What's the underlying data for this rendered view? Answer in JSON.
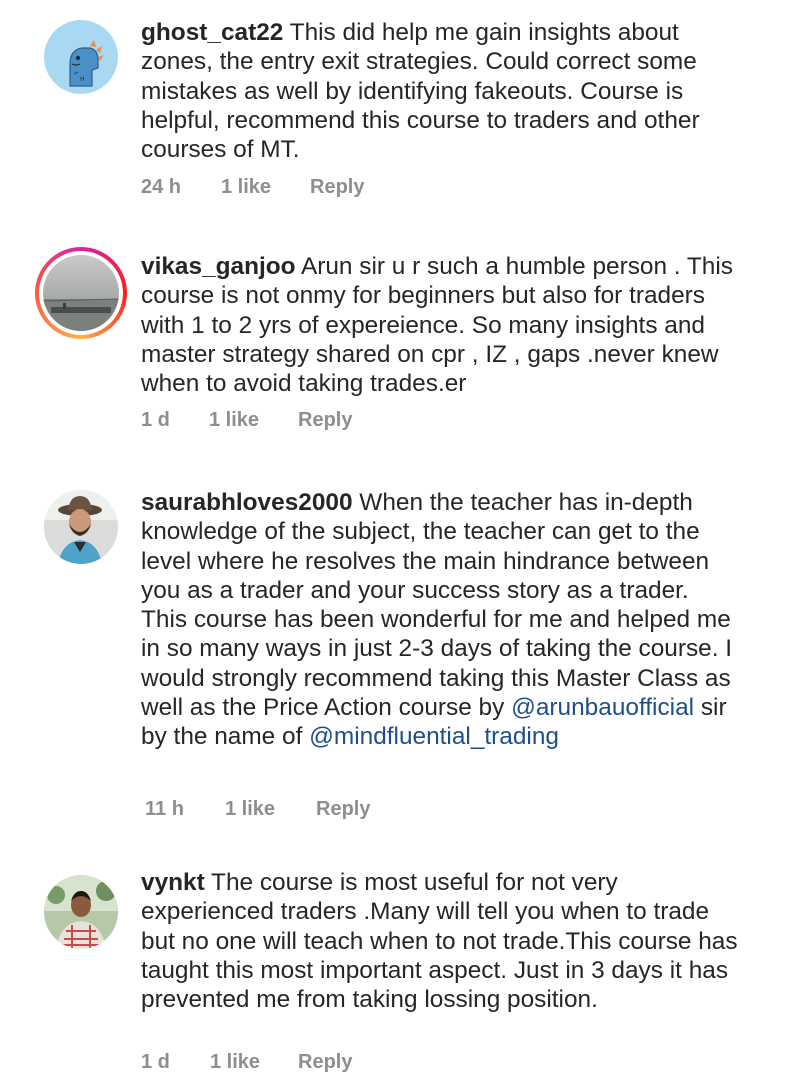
{
  "comments": [
    {
      "username": "ghost_cat22",
      "text": " This did help me gain insights about zones, the entry exit strategies. Could correct some mistakes as well  by identifying fakeouts. Course is helpful, recommend this course to traders and other courses of MT.",
      "time": "24 h",
      "likes": "1 like",
      "reply": "Reply",
      "avatar_icon": "dinosaur-avatar-icon"
    },
    {
      "username": "vikas_ganjoo",
      "text": " Arun sir u r such a humble person . This course is not onmy for beginners but also for traders with 1 to 2 yrs of expereience. So many insights and master strategy shared on cpr , IZ , gaps .never knew when to avoid taking trades.er",
      "time": "1 d",
      "likes": "1 like",
      "reply": "Reply",
      "avatar_icon": "sea-photo-avatar-icon"
    },
    {
      "username": "saurabhloves2000",
      "text_part1": " When the teacher has in-depth knowledge of the subject, the teacher can get to the level where he resolves the main hindrance between you as a trader and your success story as a trader. This course has been wonderful for me and helped me in so many ways in just 2-3 days of taking the course. I would strongly recommend taking this Master Class as well as the Price Action course by ",
      "mention1": "@arunbauofficial",
      "text_part2": " sir by the name of ",
      "mention2": "@mindfluential_trading",
      "time": "11 h",
      "likes": "1 like",
      "reply": "Reply",
      "avatar_icon": "man-hat-avatar-icon"
    },
    {
      "username": "vynkt",
      "text": " The course is most useful for not very experienced traders .Many will tell you when to trade but no one will teach when to not trade.This course has taught this most important aspect. Just in 3 days it has prevented me from taking lossing position.",
      "time": "1 d",
      "likes": "1 like",
      "reply": "Reply",
      "avatar_icon": "man-outdoor-avatar-icon"
    }
  ],
  "colors": {
    "text": "#262626",
    "meta": "#8e8e8e",
    "mention": "#1f4f8a",
    "avatar1_bg": "#a8d8f0"
  }
}
